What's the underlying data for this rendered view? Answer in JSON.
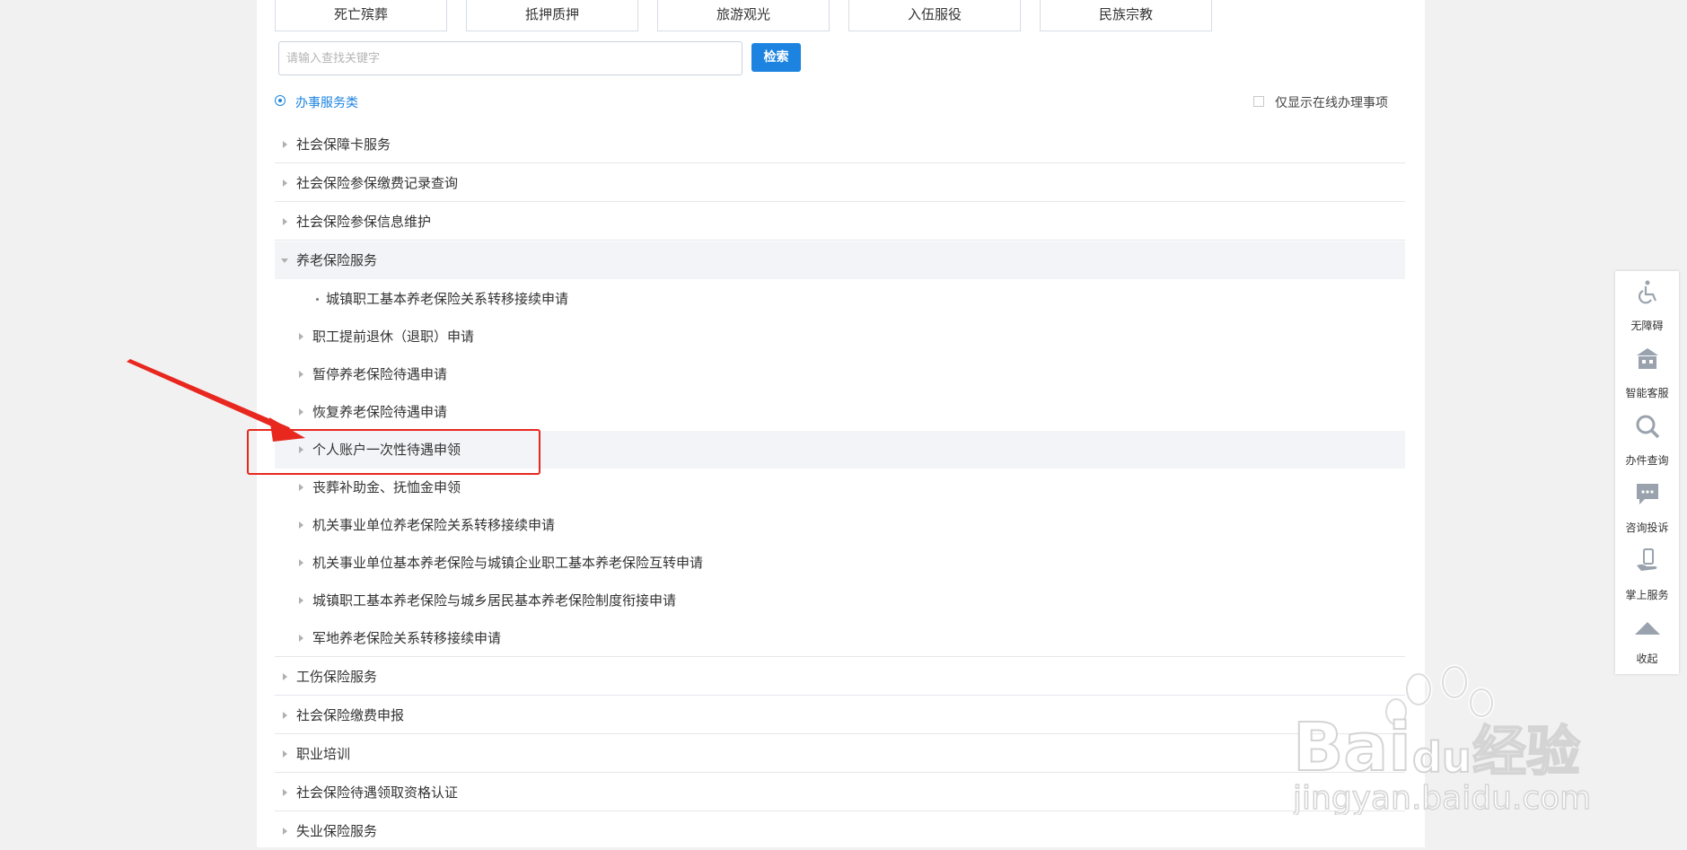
{
  "categories": [
    "死亡殡葬",
    "抵押质押",
    "旅游观光",
    "入伍服役",
    "民族宗教"
  ],
  "search": {
    "placeholder": "请输入查找关键字",
    "button_label": "检索"
  },
  "filter": {
    "radio_label": "办事服务类",
    "checkbox_label": "仅显示在线办理事项"
  },
  "list": {
    "items": [
      {
        "label": "社会保障卡服务"
      },
      {
        "label": "社会保险参保缴费记录查询"
      },
      {
        "label": "社会保险参保信息维护"
      },
      {
        "label": "养老保险服务",
        "expanded": true,
        "children": [
          {
            "label": "城镇职工基本养老保险关系转移接续申请",
            "marker": "dot"
          },
          {
            "label": "职工提前退休（退职）申请"
          },
          {
            "label": "暂停养老保险待遇申请"
          },
          {
            "label": "恢复养老保险待遇申请"
          },
          {
            "label": "个人账户一次性待遇申领",
            "highlighted": true
          },
          {
            "label": "丧葬补助金、抚恤金申领"
          },
          {
            "label": "机关事业单位养老保险关系转移接续申请"
          },
          {
            "label": "机关事业单位基本养老保险与城镇企业职工基本养老保险互转申请"
          },
          {
            "label": "城镇职工基本养老保险与城乡居民基本养老保险制度衔接申请"
          },
          {
            "label": "军地养老保险关系转移接续申请"
          }
        ]
      },
      {
        "label": "工伤保险服务"
      },
      {
        "label": "社会保险缴费申报"
      },
      {
        "label": "职业培训"
      },
      {
        "label": "社会保险待遇领取资格认证"
      },
      {
        "label": "失业保险服务"
      }
    ]
  },
  "toolbar": {
    "items": [
      {
        "label": "无障碍",
        "icon": "wheelchair-icon"
      },
      {
        "label": "智能客服",
        "icon": "robot-icon"
      },
      {
        "label": "办件查询",
        "icon": "search-icon"
      },
      {
        "label": "咨询投诉",
        "icon": "chat-icon"
      },
      {
        "label": "掌上服务",
        "icon": "phone-hand-icon"
      },
      {
        "label": "收起",
        "icon": "collapse-up-icon"
      }
    ]
  },
  "watermark": {
    "brand": "Bai",
    "brand2": "du",
    "brand_cn": "经验",
    "url": "jingyan.baidu.com"
  },
  "colors": {
    "accent": "#1c84e0",
    "annotation": "#e8271f",
    "highlight_bg": "#f2f4f7"
  }
}
